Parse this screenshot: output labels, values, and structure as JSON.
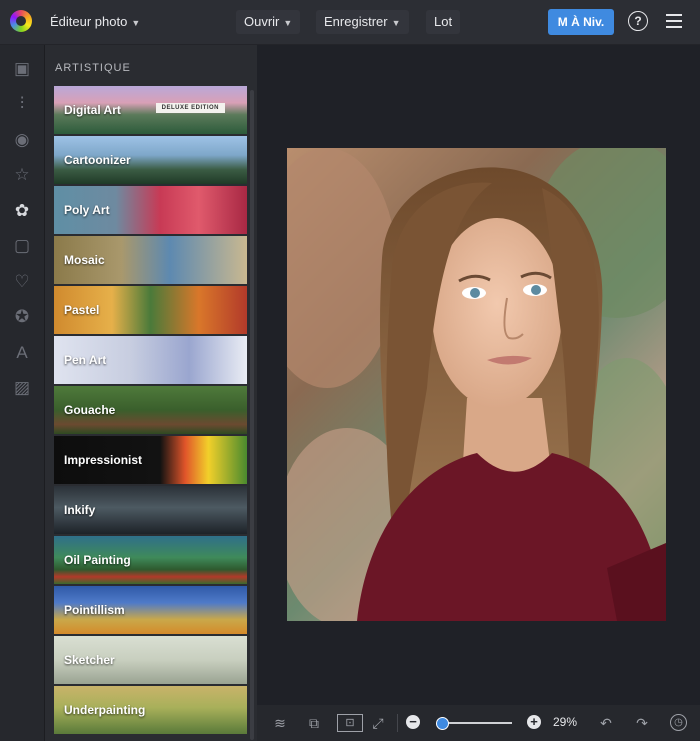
{
  "header": {
    "app_menu": "Éditeur photo",
    "open": "Ouvrir",
    "save": "Enregistrer",
    "batch": "Lot",
    "upgrade": "M À Niv.",
    "help": "?"
  },
  "panel": {
    "title": "ARTISTIQUE",
    "items": [
      {
        "label": "Digital Art",
        "badge": "DELUXE EDITION"
      },
      {
        "label": "Cartoonizer"
      },
      {
        "label": "Poly Art"
      },
      {
        "label": "Mosaic"
      },
      {
        "label": "Pastel"
      },
      {
        "label": "Pen Art"
      },
      {
        "label": "Gouache"
      },
      {
        "label": "Impressionist"
      },
      {
        "label": "Inkify"
      },
      {
        "label": "Oil Painting"
      },
      {
        "label": "Pointillism"
      },
      {
        "label": "Sketcher"
      },
      {
        "label": "Underpainting"
      }
    ]
  },
  "zoom": {
    "value": "29%",
    "level_fraction": 0.0
  },
  "colors": {
    "accent": "#3f8ae0",
    "background": "#1f2127",
    "topbar": "#2c2e34"
  }
}
